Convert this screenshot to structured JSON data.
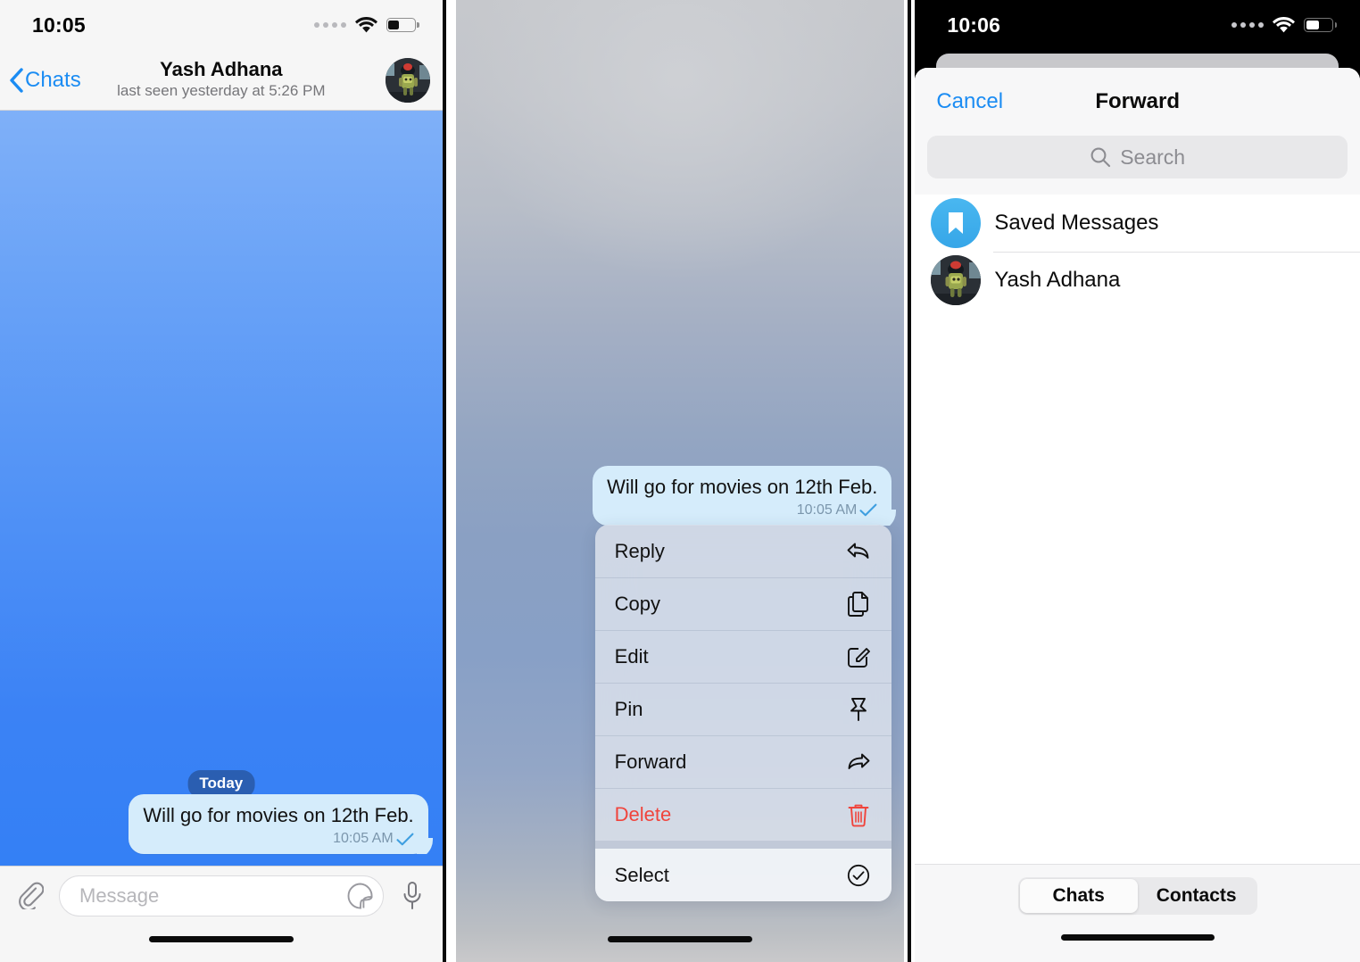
{
  "panel1": {
    "status": {
      "time": "10:05",
      "wifi_icon": "wifi-icon",
      "battery_icon": "battery-icon",
      "signal_icon": "signal-dots-icon"
    },
    "navbar": {
      "back_label": "Chats",
      "back_icon": "chevron-left-icon",
      "title": "Yash Adhana",
      "subtitle": "last seen yesterday at 5:26 PM",
      "avatar_name": "contact-avatar"
    },
    "chat": {
      "day_separator": "Today",
      "message": {
        "text": "Will go for movies on 12th Feb.",
        "time": "10:05 AM",
        "status_icon": "checkmark-icon"
      }
    },
    "input": {
      "attach_icon": "paperclip-icon",
      "placeholder": "Message",
      "sticker_icon": "sticker-icon",
      "mic_icon": "microphone-icon"
    }
  },
  "panel2": {
    "message": {
      "text": "Will go for movies on 12th Feb.",
      "time": "10:05 AM",
      "status_icon": "checkmark-icon"
    },
    "context_menu": [
      {
        "label": "Reply",
        "icon": "reply-arrow-icon",
        "danger": false
      },
      {
        "label": "Copy",
        "icon": "copy-icon",
        "danger": false
      },
      {
        "label": "Edit",
        "icon": "edit-pencil-icon",
        "danger": false
      },
      {
        "label": "Pin",
        "icon": "pin-icon",
        "danger": false
      },
      {
        "label": "Forward",
        "icon": "forward-arrow-icon",
        "danger": false
      },
      {
        "label": "Delete",
        "icon": "trash-icon",
        "danger": true
      },
      {
        "label": "Select",
        "icon": "check-circle-icon",
        "danger": false
      }
    ]
  },
  "panel3": {
    "status": {
      "time": "10:06",
      "wifi_icon": "wifi-icon",
      "battery_icon": "battery-icon",
      "signal_icon": "signal-dots-icon"
    },
    "sheet": {
      "cancel_label": "Cancel",
      "title": "Forward",
      "search_placeholder": "Search",
      "search_icon": "search-icon",
      "rows": [
        {
          "label": "Saved Messages",
          "avatar": "bookmark-icon"
        },
        {
          "label": "Yash Adhana",
          "avatar": "contact-avatar"
        }
      ],
      "tabs": [
        {
          "label": "Chats",
          "active": true
        },
        {
          "label": "Contacts",
          "active": false
        }
      ]
    }
  },
  "colors": {
    "accent_blue": "#1b8cf3",
    "bubble_blue": "#d5ecfb",
    "danger_red": "#f0443c",
    "saved_badge_blue": "#49b7f0",
    "chat_bg_top": "#7fb0f8",
    "chat_bg_bottom": "#3480f5"
  }
}
